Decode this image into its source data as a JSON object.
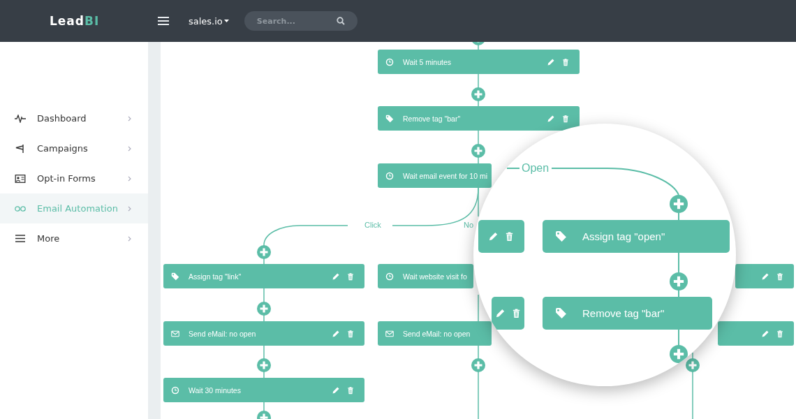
{
  "header": {
    "logo_text": "Lead",
    "logo_accent": "BI",
    "account": "sales.io",
    "search": {
      "placeholder": "Search..."
    }
  },
  "sidebar": {
    "items": [
      {
        "label": "Dashboard",
        "kind": "pulse",
        "selected": false
      },
      {
        "label": "Campaigns",
        "kind": "flag",
        "selected": false
      },
      {
        "label": "Opt-in Forms",
        "kind": "card",
        "selected": false
      },
      {
        "label": "Email Automation",
        "kind": "infinity",
        "selected": true
      },
      {
        "label": "More",
        "kind": "lines",
        "selected": false
      }
    ]
  },
  "flow": {
    "nodes": [
      {
        "kind": "wait",
        "label": "Wait 5 minutes",
        "actions": true
      },
      {
        "kind": "tag",
        "label": "Remove tag \"bar\"",
        "actions": true
      },
      {
        "kind": "wait",
        "label": "Wait email event for 10 mi",
        "actions": false
      },
      {
        "kind": "tag",
        "label": "Assign tag \"link\"",
        "actions": true
      },
      {
        "kind": "wait",
        "label": "Wait website visit fo",
        "actions": false
      },
      {
        "actions": true
      },
      {
        "kind": "email",
        "label": "Send eMail: no open",
        "actions": true
      },
      {
        "kind": "email",
        "label": "Send eMail: no open",
        "actions": false
      },
      {
        "actions": true
      },
      {
        "kind": "wait",
        "label": "Wait 30 minutes",
        "actions": true
      }
    ],
    "edge_labels": [
      "Click",
      "No"
    ]
  },
  "magnifier": {
    "edge_label": "Open",
    "nodes": [
      {
        "actions": true
      },
      {
        "actions": true
      },
      {
        "kind": "tag",
        "label": "Assign tag \"open\"",
        "actions": false
      },
      {
        "kind": "tag",
        "label": "Remove tag \"bar\"",
        "actions": false
      }
    ]
  }
}
